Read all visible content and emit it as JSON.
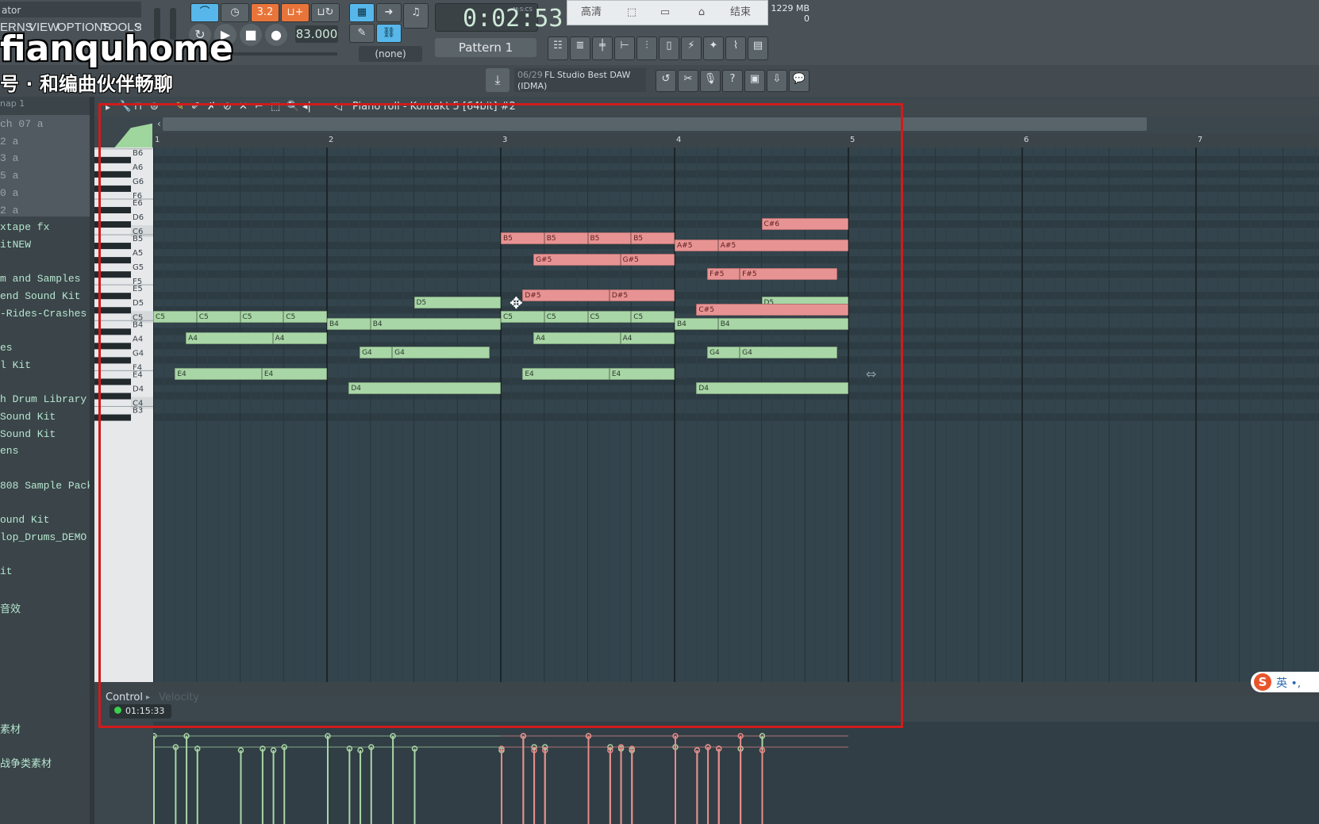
{
  "app": {
    "title_fragment": "ator"
  },
  "menu": [
    "ERNS",
    "VIEW",
    "OPTIONS",
    "TOOLS",
    "?"
  ],
  "watermark": {
    "line1": "fianquhome",
    "line2": "号 · 和编曲伙伴畅聊"
  },
  "transport": {
    "tempo": "83.000",
    "time": "0:02:53",
    "time_label": "M:S:CS",
    "pattern_label": "Pattern 1",
    "none_label": "(none)",
    "snap_label": "3.2"
  },
  "popup": {
    "btn1": "高清",
    "btn2": "结束"
  },
  "memory": {
    "mb": "1229 MB",
    "count": "0"
  },
  "hint": {
    "index": "06/29",
    "text": "FL Studio Best DAW",
    "sub": "(IDMA)"
  },
  "browser": {
    "header": "nap 1",
    "items": [
      "ch 07 a",
      "2 a",
      "3 a",
      "5 a",
      "0 a",
      "2 a",
      "xtape fx",
      "itNEW",
      "",
      "m and Samples",
      "end Sound Kit",
      "-Rides-Crashes",
      "",
      "es",
      "l Kit",
      "",
      "h Drum Library",
      "Sound Kit",
      "Sound Kit",
      "ens",
      "",
      "808 Sample Pack",
      "",
      "ound Kit",
      "lop_Drums_DEMO",
      "",
      "it",
      "",
      "音效",
      "",
      "",
      "",
      "",
      "",
      "",
      "素材",
      "",
      "战争类素材"
    ]
  },
  "pianoroll": {
    "title": "Piano roll - Kontakt 5 [64bit] #2",
    "bars": [
      "1",
      "2",
      "3",
      "4",
      "5",
      "6",
      "7"
    ],
    "key_labels": [
      "B6",
      "A6",
      "G6",
      "F6",
      "E6",
      "D6",
      "C6",
      "B5",
      "A5",
      "G5",
      "F5",
      "E5",
      "D5",
      "C5",
      "B4",
      "A4",
      "G4",
      "F4",
      "E4",
      "D4",
      "C4",
      "B3"
    ]
  },
  "notes": [
    {
      "label": "C5",
      "pitch": "C5",
      "start": 0.0,
      "len": 0.25,
      "color": "g"
    },
    {
      "label": "C5",
      "pitch": "C5",
      "start": 0.25,
      "len": 0.25,
      "color": "g"
    },
    {
      "label": "C5",
      "pitch": "C5",
      "start": 0.5,
      "len": 0.25,
      "color": "g"
    },
    {
      "label": "C5",
      "pitch": "C5",
      "start": 0.75,
      "len": 0.25,
      "color": "g"
    },
    {
      "label": "A4",
      "pitch": "A4",
      "start": 0.1875,
      "len": 0.5,
      "color": "g"
    },
    {
      "label": "A4",
      "pitch": "A4",
      "start": 0.6875,
      "len": 0.3125,
      "color": "g"
    },
    {
      "label": "E4",
      "pitch": "E4",
      "start": 0.125,
      "len": 0.5,
      "color": "g"
    },
    {
      "label": "E4",
      "pitch": "E4",
      "start": 0.625,
      "len": 0.375,
      "color": "g"
    },
    {
      "label": "B4",
      "pitch": "B4",
      "start": 1.0,
      "len": 0.25,
      "color": "g"
    },
    {
      "label": "B4",
      "pitch": "B4",
      "start": 1.25,
      "len": 0.75,
      "color": "g"
    },
    {
      "label": "D5",
      "pitch": "D5",
      "start": 1.5,
      "len": 0.5,
      "color": "g"
    },
    {
      "label": "G4",
      "pitch": "G4",
      "start": 1.1875,
      "len": 0.1875,
      "color": "g"
    },
    {
      "label": "G4",
      "pitch": "G4",
      "start": 1.375,
      "len": 0.5625,
      "color": "g"
    },
    {
      "label": "D4",
      "pitch": "D4",
      "start": 1.125,
      "len": 0.875,
      "color": "g"
    },
    {
      "label": "C5",
      "pitch": "C5",
      "start": 2.0,
      "len": 0.25,
      "color": "g"
    },
    {
      "label": "C5",
      "pitch": "C5",
      "start": 2.25,
      "len": 0.25,
      "color": "g"
    },
    {
      "label": "C5",
      "pitch": "C5",
      "start": 2.5,
      "len": 0.25,
      "color": "g"
    },
    {
      "label": "C5",
      "pitch": "C5",
      "start": 2.75,
      "len": 0.25,
      "color": "g"
    },
    {
      "label": "A4",
      "pitch": "A4",
      "start": 2.1875,
      "len": 0.5,
      "color": "g"
    },
    {
      "label": "A4",
      "pitch": "A4",
      "start": 2.6875,
      "len": 0.3125,
      "color": "g"
    },
    {
      "label": "E4",
      "pitch": "E4",
      "start": 2.125,
      "len": 0.5,
      "color": "g"
    },
    {
      "label": "E4",
      "pitch": "E4",
      "start": 2.625,
      "len": 0.375,
      "color": "g"
    },
    {
      "label": "B5",
      "pitch": "B5",
      "start": 2.0,
      "len": 0.25,
      "color": "r"
    },
    {
      "label": "B5",
      "pitch": "B5",
      "start": 2.25,
      "len": 0.25,
      "color": "r"
    },
    {
      "label": "B5",
      "pitch": "B5",
      "start": 2.5,
      "len": 0.25,
      "color": "r"
    },
    {
      "label": "B5",
      "pitch": "B5",
      "start": 2.75,
      "len": 0.25,
      "color": "r"
    },
    {
      "label": "G#5",
      "pitch": "G#5",
      "start": 2.1875,
      "len": 0.5,
      "color": "r"
    },
    {
      "label": "G#5",
      "pitch": "G#5",
      "start": 2.6875,
      "len": 0.3125,
      "color": "r"
    },
    {
      "label": "D#5",
      "pitch": "D#5",
      "start": 2.125,
      "len": 0.5,
      "color": "r"
    },
    {
      "label": "D#5",
      "pitch": "D#5",
      "start": 2.625,
      "len": 0.375,
      "color": "r"
    },
    {
      "label": "B4",
      "pitch": "B4",
      "start": 3.0,
      "len": 0.25,
      "color": "g"
    },
    {
      "label": "B4",
      "pitch": "B4",
      "start": 3.25,
      "len": 0.75,
      "color": "g"
    },
    {
      "label": "D5",
      "pitch": "D5",
      "start": 3.5,
      "len": 0.5,
      "color": "g"
    },
    {
      "label": "G4",
      "pitch": "G4",
      "start": 3.1875,
      "len": 0.1875,
      "color": "g"
    },
    {
      "label": "G4",
      "pitch": "G4",
      "start": 3.375,
      "len": 0.5625,
      "color": "g"
    },
    {
      "label": "D4",
      "pitch": "D4",
      "start": 3.125,
      "len": 0.875,
      "color": "g"
    },
    {
      "label": "A#5",
      "pitch": "A#5",
      "start": 3.0,
      "len": 0.25,
      "color": "r"
    },
    {
      "label": "A#5",
      "pitch": "A#5",
      "start": 3.25,
      "len": 0.75,
      "color": "r"
    },
    {
      "label": "C#6",
      "pitch": "C#6",
      "start": 3.5,
      "len": 0.5,
      "color": "r"
    },
    {
      "label": "F#5",
      "pitch": "F#5",
      "start": 3.1875,
      "len": 0.1875,
      "color": "r"
    },
    {
      "label": "F#5",
      "pitch": "F#5",
      "start": 3.375,
      "len": 0.5625,
      "color": "r"
    },
    {
      "label": "C#5",
      "pitch": "C#5",
      "start": 3.125,
      "len": 0.875,
      "color": "r"
    }
  ],
  "control": {
    "label": "Control",
    "param": "Velocity",
    "timer": "01:15:33"
  },
  "ime": {
    "text": "英 •,"
  },
  "colors": {
    "green_note": "#a9d6a6",
    "red_note": "#e89393",
    "frame": "#d11b1b",
    "accent": "#57b7ea"
  }
}
